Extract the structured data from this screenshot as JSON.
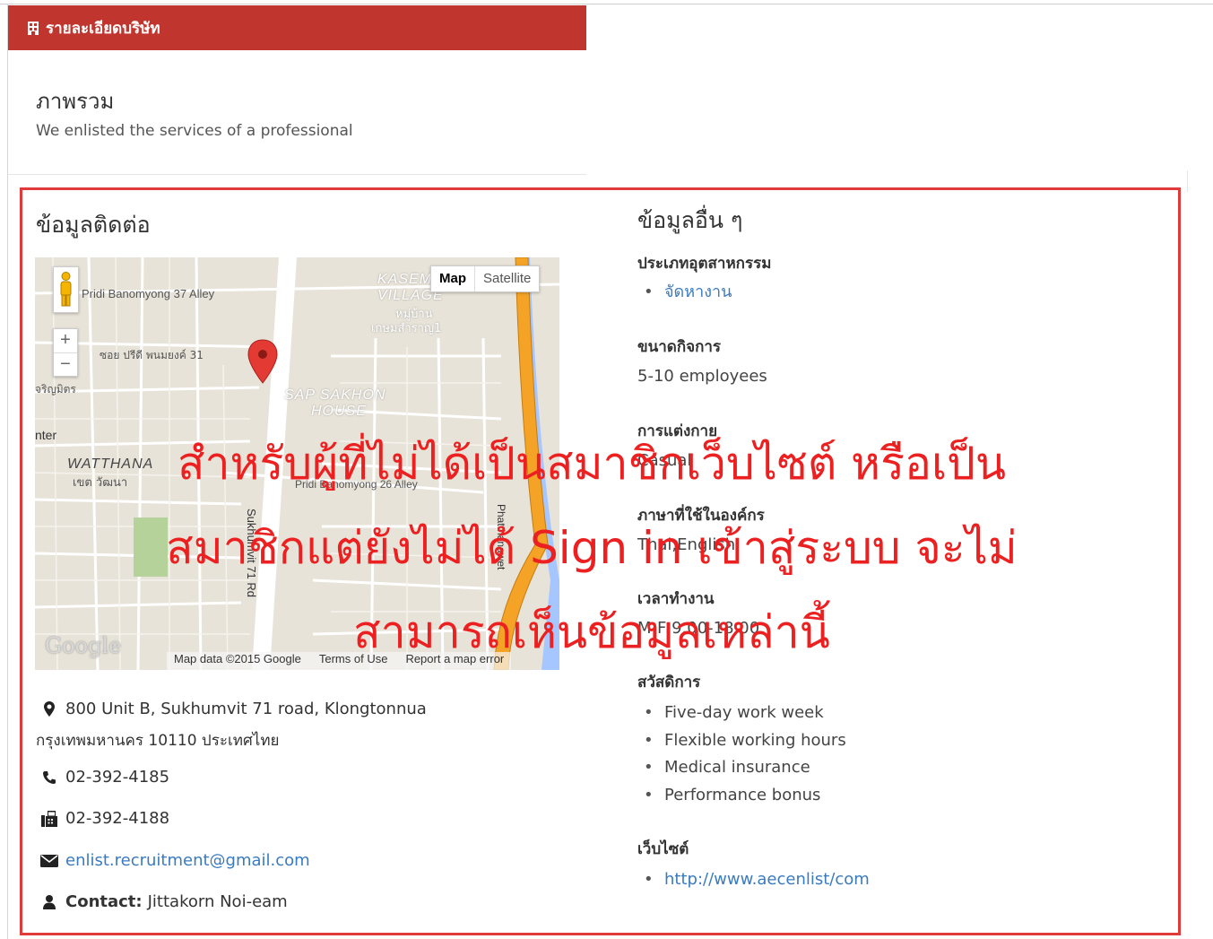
{
  "header": {
    "title": "รายละเอียดบริษัท",
    "icon": "building-icon"
  },
  "overview": {
    "title": "ภาพรวม",
    "text": "We enlisted the services of a professional"
  },
  "contact": {
    "title": "ข้อมูลติดต่อ",
    "address_line1": "800 Unit B, Sukhumvit 71 road, Klongtonnua",
    "address_line2": "กรุงเทพมหานคร 10110 ประเทศไทย",
    "phone": "02-392-4185",
    "fax": "02-392-4188",
    "email": "enlist.recruitment@gmail.com",
    "contact_label": "Contact:",
    "contact_name": "Jittakorn Noi-eam"
  },
  "map": {
    "type_map": "Map",
    "type_satellite": "Satellite",
    "zoom_in": "+",
    "zoom_out": "−",
    "logo": "Google",
    "map_data": "Map data ©2015 Google",
    "terms": "Terms of Use",
    "report": "Report a map error",
    "labels": {
      "pridi37": "Pridi Banomyong 37 Alley",
      "kasem_village": "KASEM VILLAGE",
      "kasem_th1": "หมู่บ้าน",
      "kasem_th2": "เกษมสำราญ1",
      "soi_pridi31": "ซอย ปรีดี พนมยงค์ 31",
      "charoen": "จริญมิตร",
      "sap_sakhon": "SAP SAKHON",
      "house": "HOUSE",
      "nter": "nter",
      "watthana": "WATTHANA",
      "watthana_th": "เขต วัฒนา",
      "pridi26": "Pridi Banomyong 26 Alley",
      "sukhumvit71": "Sukhumvit 71 Rd",
      "phatthanawet": "Phatthanawet"
    }
  },
  "other": {
    "title": "ข้อมูลอื่น ๆ",
    "industry_label": "ประเภทอุตสาหกรรม",
    "industry_items": [
      "จัดหางาน"
    ],
    "size_label": "ขนาดกิจการ",
    "size_value": "5-10 employees",
    "dress_label": "การแต่งกาย",
    "dress_value": "Casual",
    "language_label": "ภาษาที่ใช้ในองค์กร",
    "language_value": "Thai,English",
    "hours_label": "เวลาทำงาน",
    "hours_value": "M-F 9.00-18.00",
    "benefits_label": "สวัสดิการ",
    "benefits": [
      "Five-day work week",
      "Flexible working hours",
      "Medical insurance",
      "Performance bonus"
    ],
    "website_label": "เว็บไซต์",
    "website": "http://www.aecenlist/com"
  },
  "notice": {
    "line1": "สำหรับผู้ที่ไม่ได้เป็นสมาชิกเว็บไซต์ หรือเป็น",
    "line2": "สมาชิกแต่ยังไม่ได้ Sign in เข้าสู่ระบบ จะไม่",
    "line3": "สามารถเห็นข้อมูลเหล่านี้"
  },
  "colors": {
    "header": "#c0362f",
    "frame": "#e03a3a",
    "notice": "#ec2020",
    "link": "#3a7bbf",
    "highway": "#f4a326"
  }
}
